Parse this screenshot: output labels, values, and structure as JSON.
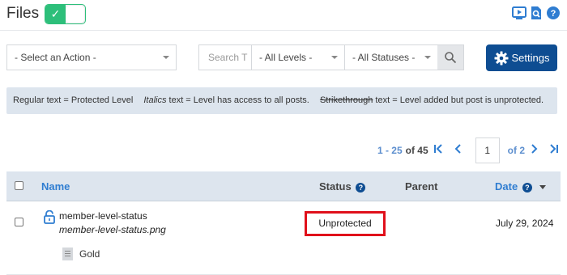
{
  "header": {
    "title": "Files",
    "toggle": {
      "state": "on",
      "check_glyph": "✓"
    },
    "icons": [
      "video-icon",
      "file-search-icon",
      "help-icon"
    ]
  },
  "toolbar": {
    "action_select": "- Select an Action -",
    "search_placeholder": "Search T",
    "levels_select": "- All Levels -",
    "statuses_select": "- All Statuses -",
    "settings_label": "Settings"
  },
  "legend": {
    "regular": "Regular text = Protected Level",
    "italics_word": "Italics",
    "italics_rest": " text = Level has access to all posts.",
    "strike_word": "Strikethrough",
    "strike_rest": " text = Level added but post is unprotected."
  },
  "pagination": {
    "range": "1 - 25",
    "total_label": "of 45",
    "page": "1",
    "of_pages": "of 2"
  },
  "table": {
    "headers": {
      "name": "Name",
      "status": "Status",
      "parent": "Parent",
      "date": "Date"
    },
    "help_glyph": "?",
    "rows": [
      {
        "name": "member-level-status",
        "file": "member-level-status.png",
        "status": "Unprotected",
        "date": "July 29, 2024",
        "level": "Gold"
      }
    ]
  },
  "colors": {
    "accent": "#2f7dd1",
    "primary_button": "#0e4d92",
    "toggle_green": "#2dbf7a",
    "highlight_red": "#e0101b",
    "bar_bg": "#dde5ee"
  }
}
